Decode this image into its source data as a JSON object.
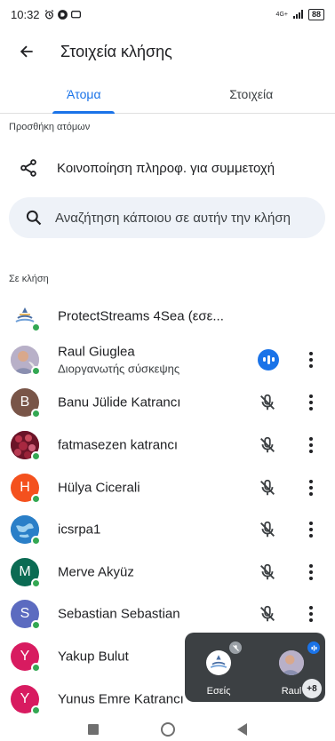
{
  "status_bar": {
    "time": "10:32",
    "network": "4G+",
    "battery": "88"
  },
  "app_bar": {
    "title": "Στοιχεία κλήσης"
  },
  "tabs": [
    {
      "label": "Άτομα",
      "active": true
    },
    {
      "label": "Στοιχεία",
      "active": false
    }
  ],
  "add_people": {
    "section_label": "Προσθήκη ατόμων",
    "share_label": "Κοινοποίηση πληροφ. για συμμετοχή"
  },
  "search": {
    "placeholder": "Αναζήτηση κάποιου σε αυτήν την κλήση"
  },
  "in_call": {
    "section_label": "Σε κλήση",
    "participants": [
      {
        "name": "ProtectStreams 4Sea (εσε...",
        "subtitle": "",
        "state": "none",
        "avatar": "logo"
      },
      {
        "name": "Raul Giuglea",
        "subtitle": "Διοργανωτής σύσκεψης",
        "state": "speaking",
        "avatar": "photo"
      },
      {
        "name": "Banu Jülide Katrancı",
        "subtitle": "",
        "state": "muted",
        "avatar": "B",
        "color": "#795548"
      },
      {
        "name": "fatmasezen katrancı",
        "subtitle": "",
        "state": "muted",
        "avatar": "photo-flowers"
      },
      {
        "name": "Hülya Cicerali",
        "subtitle": "",
        "state": "muted",
        "avatar": "H",
        "color": "#f4511e"
      },
      {
        "name": "icsrpa1",
        "subtitle": "",
        "state": "muted",
        "avatar": "globe"
      },
      {
        "name": "Merve Akyüz",
        "subtitle": "",
        "state": "muted",
        "avatar": "M",
        "color": "#0b6b53"
      },
      {
        "name": "Sebastian Sebastian",
        "subtitle": "",
        "state": "muted",
        "avatar": "S",
        "color": "#5c6bc0"
      },
      {
        "name": "Yakup Bulut",
        "subtitle": "",
        "state": "muted",
        "avatar": "Y",
        "color": "#d81b60"
      },
      {
        "name": "Yunus Emre Katrancı",
        "subtitle": "",
        "state": "muted",
        "avatar": "Y",
        "color": "#d81b60"
      }
    ]
  },
  "pip": {
    "self_label": "Εσείς",
    "other_label": "Raul",
    "extra_count": "+8"
  },
  "colors": {
    "accent": "#1a73e8",
    "online": "#34a853",
    "pip_bg": "#3c4043"
  }
}
